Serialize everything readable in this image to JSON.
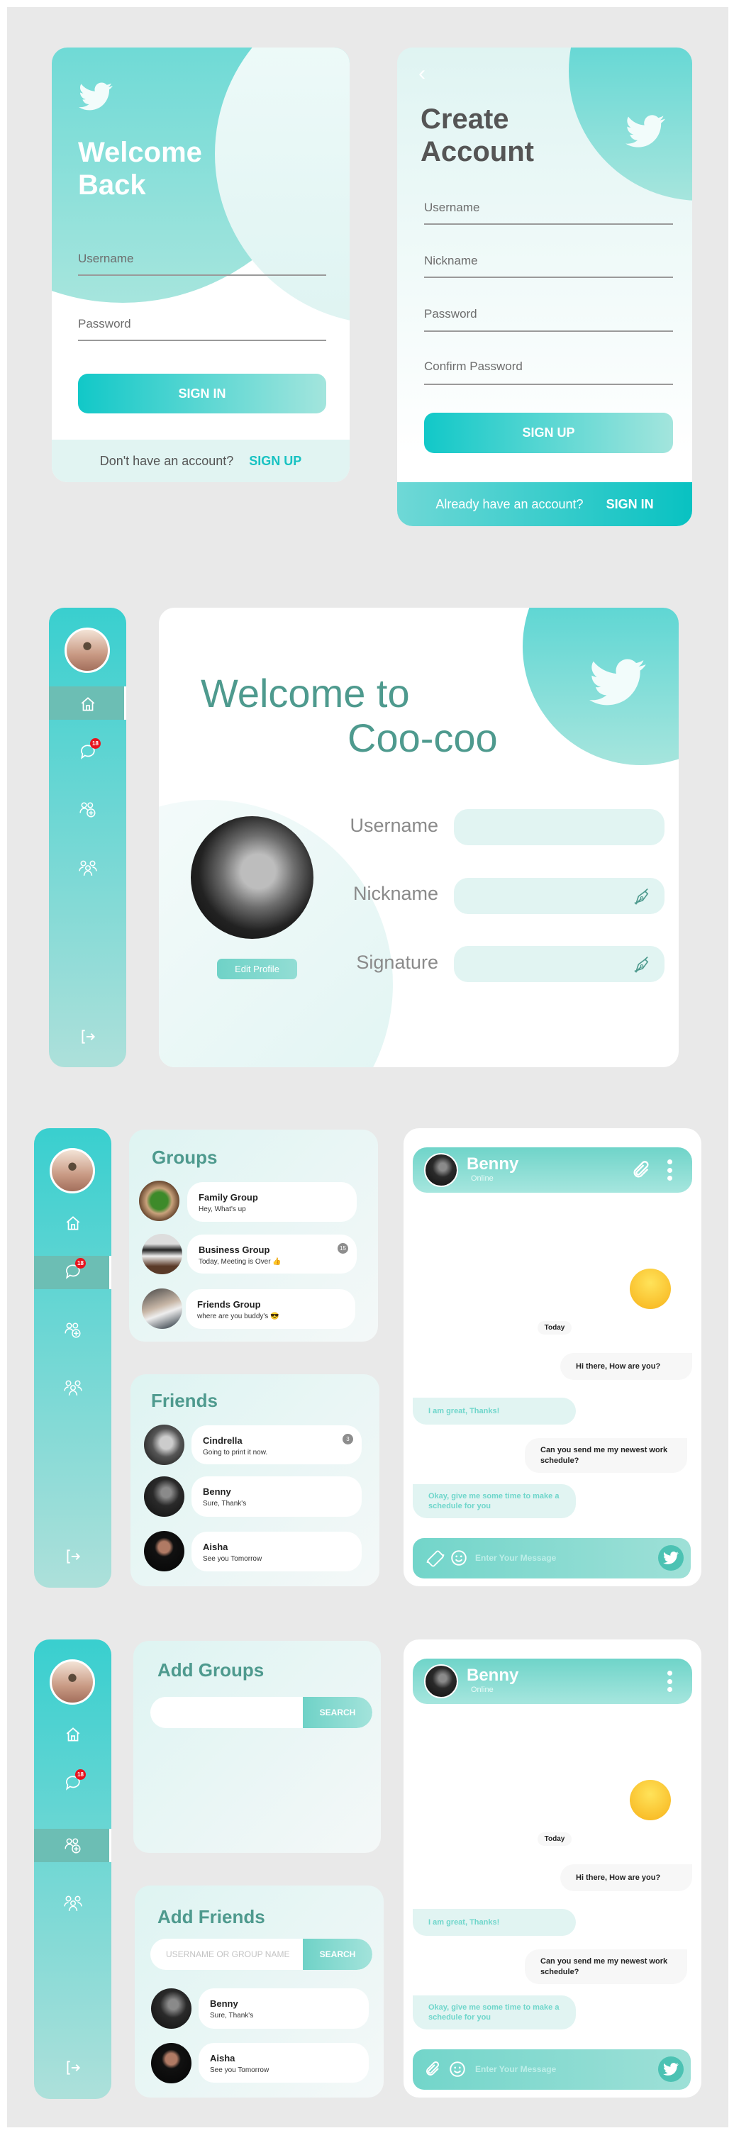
{
  "colors": {
    "accent": "#3ccfcf",
    "title_teal": "#4e9a8e",
    "badge_red": "#e8141e"
  },
  "login": {
    "title_line1": "Welcome",
    "title_line2": "Back",
    "username_label": "Username",
    "password_label": "Password",
    "sign_in": "SIGN IN",
    "footer_text": "Don't have an account?",
    "footer_link": "SIGN UP",
    "icon": "twitter-bird-icon"
  },
  "register": {
    "title_line1": "Create",
    "title_line2": "Account",
    "fields": [
      "Username",
      "Nickname",
      "Password",
      "Confirm Password"
    ],
    "sign_up": "SIGN UP",
    "footer_text": "Already have an account?",
    "footer_link": "SIGN IN",
    "back_icon": "chevron-left-icon"
  },
  "sidebar": {
    "badge": "18",
    "items": [
      "home-icon",
      "chat-icon",
      "add-friend-icon",
      "groups-icon",
      "logout-icon"
    ]
  },
  "profile": {
    "title_line1": "Welcome to",
    "title_line2": "Coo-coo",
    "edit_button": "Edit Profile",
    "fields": [
      {
        "label": "Username",
        "value": ""
      },
      {
        "label": "Nickname",
        "value": ""
      },
      {
        "label": "Signature",
        "value": ""
      }
    ]
  },
  "groups": {
    "title": "Groups",
    "items": [
      {
        "name": "Family Group",
        "message": "Hey, What's up",
        "count": ""
      },
      {
        "name": "Business Group",
        "message": "Today, Meeting is Over 👍",
        "count": "15"
      },
      {
        "name": "Friends Group",
        "message": "where are you buddy's 😎",
        "count": ""
      }
    ]
  },
  "friends": {
    "title": "Friends",
    "items": [
      {
        "name": "Cindrella",
        "message": "Going to print it now.",
        "count": "3"
      },
      {
        "name": "Benny",
        "message": "Sure, Thank's",
        "count": ""
      },
      {
        "name": "Aisha",
        "message": "See you Tomorrow",
        "count": ""
      }
    ]
  },
  "chat": {
    "contact": "Benny",
    "status": "Online",
    "date_label": "Today",
    "messages": [
      {
        "dir": "out",
        "text": "Hi there, How are you?"
      },
      {
        "dir": "in",
        "text": "I am great, Thanks!"
      },
      {
        "dir": "out",
        "text": "Can you send me my newest work schedule?"
      },
      {
        "dir": "in",
        "text": "Okay, give me some time to make a schedule for you"
      }
    ],
    "input_placeholder": "Enter Your Message"
  },
  "add_groups": {
    "title": "Add Groups",
    "search_placeholder": "",
    "search_button": "SEARCH"
  },
  "add_friends": {
    "title": "Add Friends",
    "search_placeholder": "USERNAME OR GROUP NAME",
    "search_button": "SEARCH",
    "items": [
      {
        "name": "Benny",
        "message": "Sure, Thank's"
      },
      {
        "name": "Aisha",
        "message": "See you Tomorrow"
      }
    ]
  }
}
